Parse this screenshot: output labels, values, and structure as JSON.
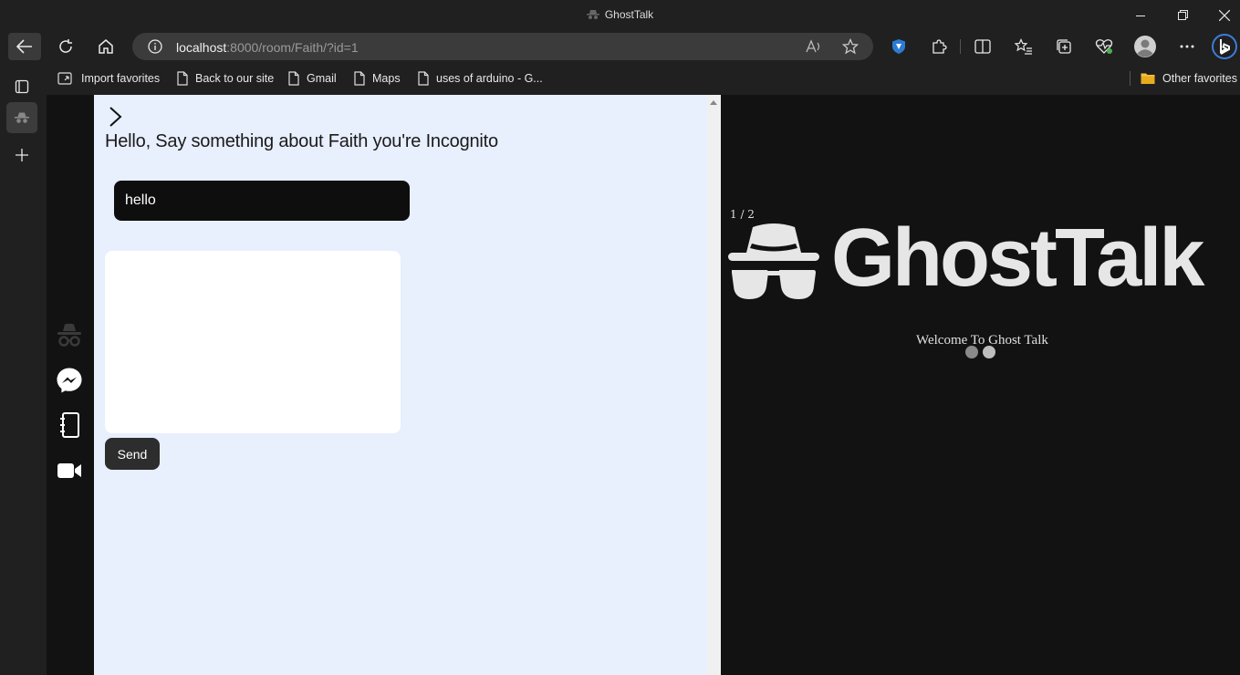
{
  "window": {
    "title": "GhostTalk"
  },
  "toolbar": {
    "url_host": "localhost",
    "url_rest": ":8000/room/Faith/?id=1"
  },
  "bookmarks": {
    "items": [
      {
        "label": "Import favorites",
        "icon": "import-icon"
      },
      {
        "label": "Back to our site",
        "icon": "page-icon"
      },
      {
        "label": "Gmail",
        "icon": "page-icon"
      },
      {
        "label": "Maps",
        "icon": "page-icon"
      },
      {
        "label": "uses of arduino - G...",
        "icon": "page-icon"
      }
    ],
    "other": "Other favorites"
  },
  "chat": {
    "greeting": "Hello, Say something about Faith you're Incognito",
    "name_value": "hello",
    "message_value": "",
    "send_label": "Send"
  },
  "splash": {
    "counter": "1 / 2",
    "logo_text": "GhostTalk",
    "welcome": "Welcome To Ghost Talk"
  },
  "colors": {
    "chat_bg": "#e8effd",
    "page_bg": "#121212",
    "input_bg": "#0e0e0e",
    "send_bg": "#2d2d2d",
    "logo": "#e6e6e6"
  }
}
